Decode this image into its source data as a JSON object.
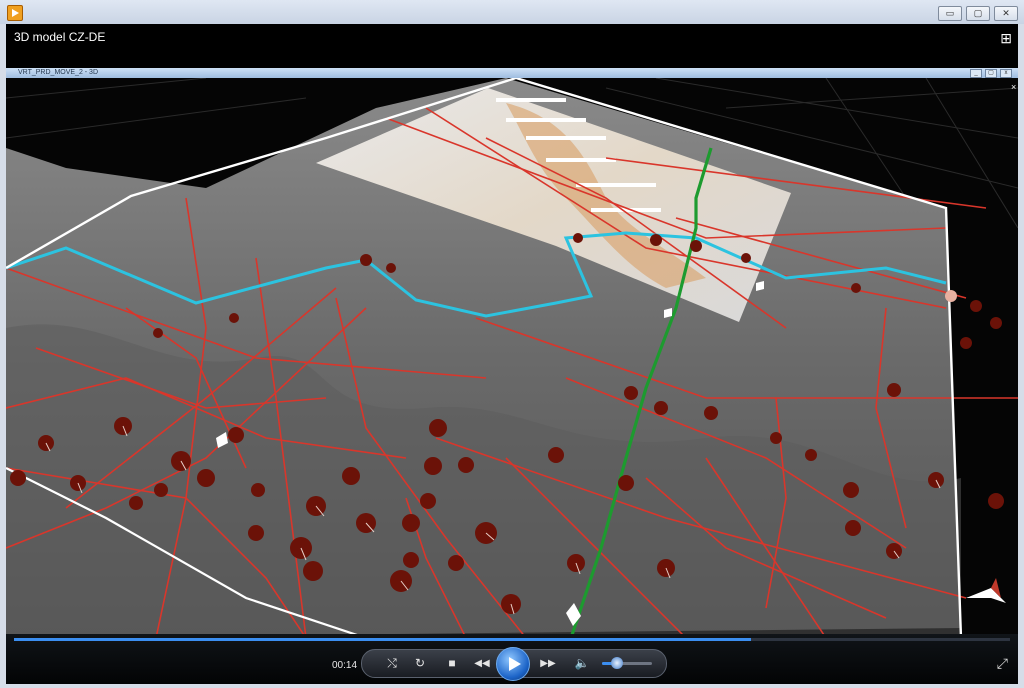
{
  "window": {
    "title": "",
    "buttons": {
      "minimize": "▭",
      "maximize": "▢",
      "close": "✕"
    }
  },
  "player": {
    "title": "3D model CZ-DE",
    "inner_window": {
      "title": "VRT_PRD_MOVE_2 - 3D",
      "buttons": {
        "minimize": "_",
        "restore": "▢",
        "close": "x"
      }
    },
    "controls": {
      "time": "00:14",
      "progress": 0.74,
      "volume": 0.3,
      "icons": {
        "shuffle": "⤭",
        "repeat": "↻",
        "stop": "■",
        "previous": "◀◀",
        "next": "▶▶",
        "volume": "🔈",
        "fullscreen": "⤢"
      }
    },
    "colors": {
      "terrain": "#6b6b6b",
      "fault_lines": "#d9362b",
      "river": "#2cc3e0",
      "profile_line": "#1d9b2f",
      "boundary": "#ffffff",
      "seek": "#3b8ef0"
    }
  }
}
